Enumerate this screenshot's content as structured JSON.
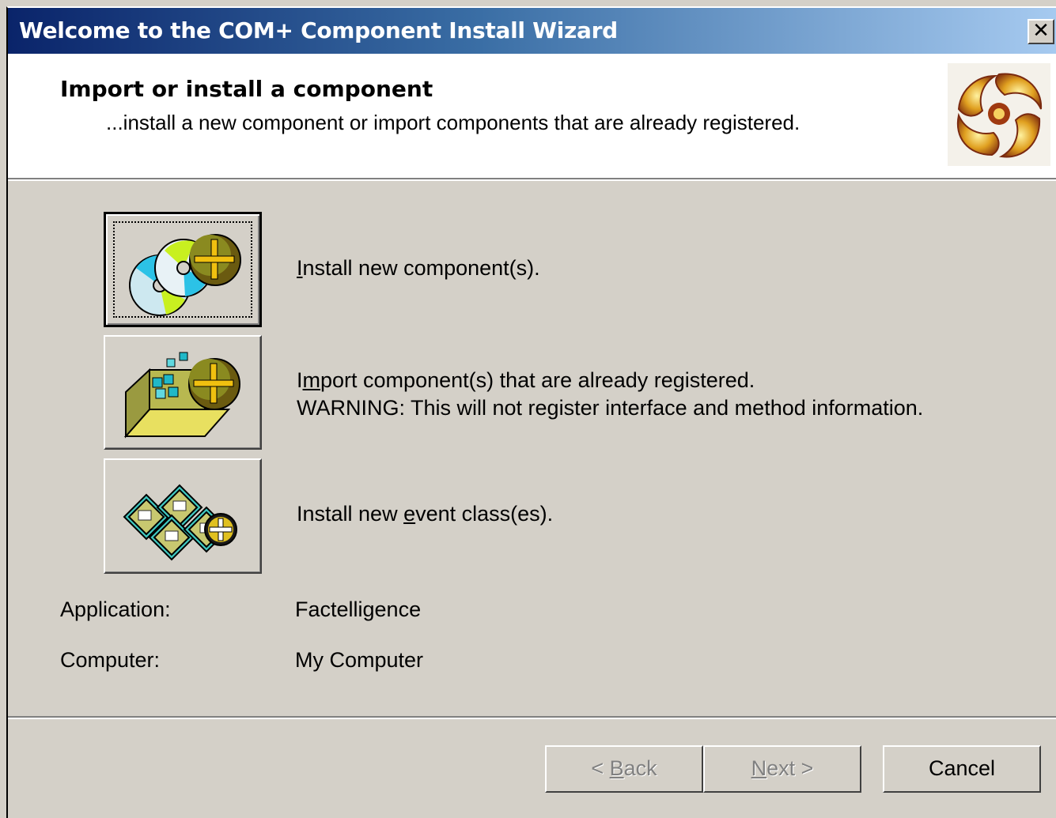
{
  "window": {
    "title": "Welcome to the COM+ Component Install Wizard",
    "close_glyph": "✕"
  },
  "header": {
    "title": "Import or install a component",
    "subtitle": "...install a new component or import components that are already registered.",
    "logo_icon": "com-plus-swirl-icon"
  },
  "options": [
    {
      "label_pre": "",
      "label_mnemonic": "I",
      "label_post": "nstall new component(s).",
      "icon": "install-components-icon",
      "is_default": true
    },
    {
      "label_pre": "I",
      "label_mnemonic": "m",
      "label_post": "port component(s) that are already registered.",
      "warning": "WARNING: This will not register interface and method information.",
      "icon": "import-components-icon",
      "is_default": false
    },
    {
      "label_pre": "Install new ",
      "label_mnemonic": "e",
      "label_post": "vent class(es).",
      "icon": "install-event-class-icon",
      "is_default": false
    }
  ],
  "info": {
    "application_label": "Application:",
    "application_value": "Factelligence",
    "computer_label": "Computer:",
    "computer_value": "My Computer"
  },
  "footer": {
    "back_pre": "< ",
    "back_mnemonic": "B",
    "back_post": "ack",
    "back_enabled": false,
    "next_pre": "",
    "next_mnemonic": "N",
    "next_post": "ext >",
    "next_enabled": false,
    "cancel_label": "Cancel"
  },
  "colors": {
    "titlebar_start": "#0a246a",
    "titlebar_end": "#a6caf0",
    "face": "#d4d0c8",
    "disabled_text": "#808080"
  }
}
